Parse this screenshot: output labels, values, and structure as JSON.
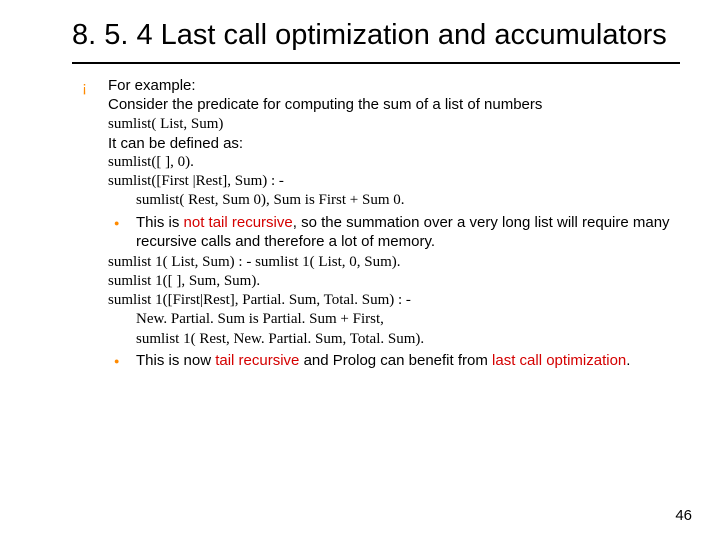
{
  "title": "8. 5. 4 Last call optimization and accumulators",
  "intro": {
    "line1": "For example:",
    "line2": "Consider the predicate for computing the sum of a list of numbers"
  },
  "code1": {
    "sig": "sumlist( List, Sum)",
    "defined": "It can be defined as:",
    "a": "sumlist([ ], 0).",
    "b": "sumlist([First |Rest], Sum) : -",
    "c": "sumlist( Rest, Sum 0), Sum is First + Sum 0."
  },
  "note1": {
    "pre": "This is ",
    "red": "not tail recursive",
    "post": ", so the summation over a very long list will require many recursive calls and therefore a lot of memory."
  },
  "code2": {
    "a": "sumlist 1( List, Sum) : - sumlist 1( List, 0, Sum).",
    "b": "sumlist 1([ ], Sum, Sum).",
    "c": "sumlist 1([First|Rest], Partial. Sum, Total. Sum) : -",
    "d": "New. Partial. Sum is Partial. Sum + First,",
    "e": "sumlist 1( Rest, New. Partial. Sum, Total. Sum)."
  },
  "note2": {
    "p1": "This is now ",
    "r1": "tail recursive",
    "p2": " and Prolog can benefit from ",
    "r2": "last call optimization",
    "p3": "."
  },
  "pagenum": "46"
}
